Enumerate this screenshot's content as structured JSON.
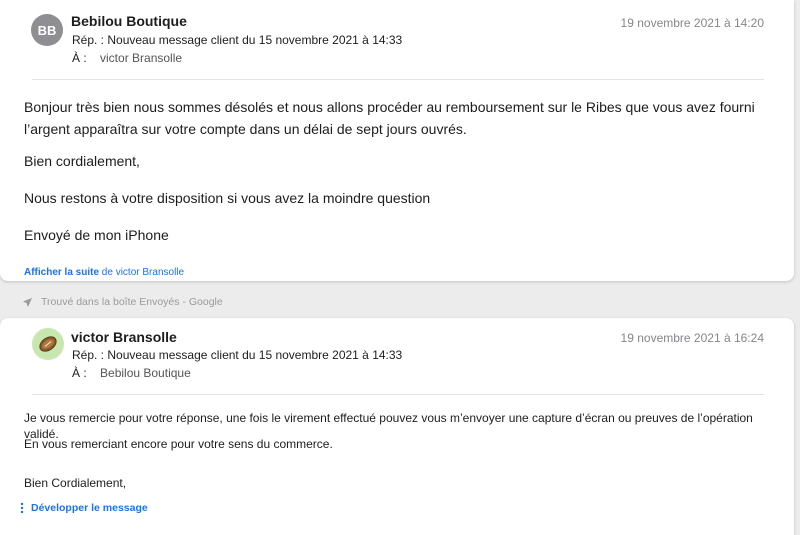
{
  "messages": [
    {
      "avatar_initials": "BB",
      "sender": "Bebilou Boutique",
      "date": "19 novembre 2021 à 14:20",
      "subject": "Rép. : Nouveau message client du 15 novembre 2021 à 14:33",
      "to_label": "À :",
      "to_name": "victor Bransolle",
      "body": [
        "Bonjour très bien nous sommes désolés et nous allons procéder au remboursement sur le Ribes que vous avez fourni l’argent apparaîtra sur votre compte dans un délai de sept jours ouvrés.",
        "Bien cordialement,",
        "Nous restons à votre disposition si vous avez la moindre question",
        "Envoyé de mon iPhone"
      ],
      "show_more_link": "Afficher la suite",
      "show_more_suffix": " de victor Bransolle"
    },
    {
      "avatar_icon": "football-avatar-icon",
      "sender": "victor Bransolle",
      "date": "19 novembre 2021 à 16:24",
      "subject": "Rép. : Nouveau message client du 15 novembre 2021 à 14:33",
      "to_label": "À :",
      "to_name": "Bebilou Boutique",
      "body": [
        "Je vous remercie pour votre réponse, une fois le virement effectué pouvez vous m’envoyer une capture d’écran ou preuves de l’opération validé.",
        "En vous remerciant encore pour votre sens du commerce.",
        "Bien Cordialement,"
      ],
      "expand_label": "Développer le message"
    }
  ],
  "found_in": "Trouvé dans la boîte Envoyés - Google",
  "colors": {
    "link": "#1a73e8",
    "avatar_gray": "#8e8e93",
    "avatar_green": "#c8e6b0"
  }
}
